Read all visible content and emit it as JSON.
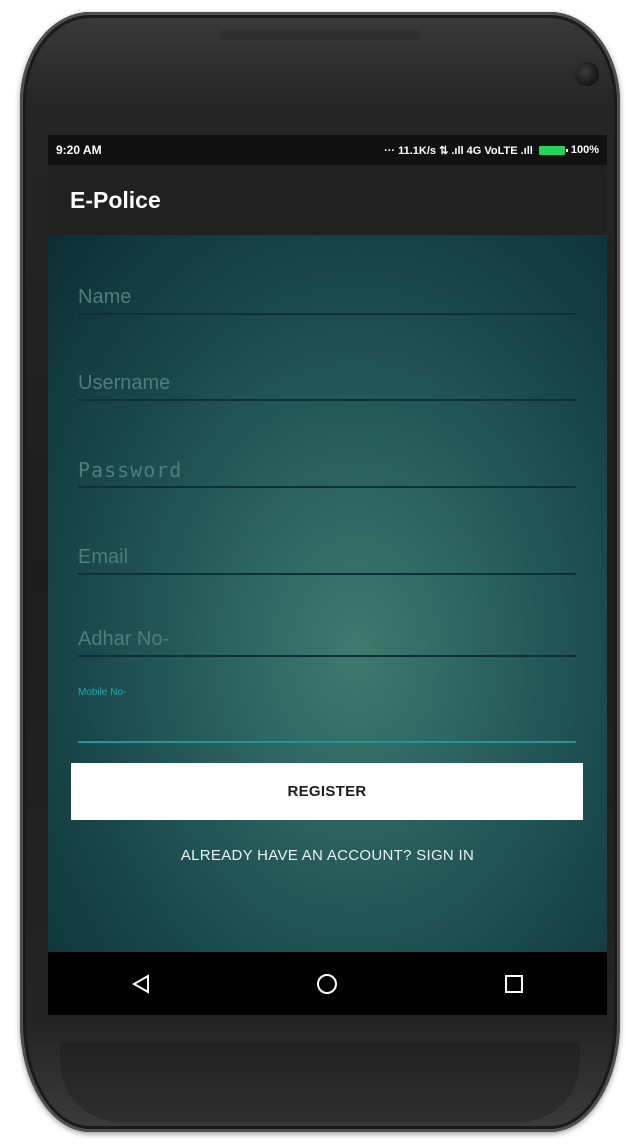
{
  "status_bar": {
    "time": "9:20 AM",
    "network_info": "··· 11.1K/s ⇅ .ıll 4G VoLTE .ıll",
    "battery": "100%",
    "battery_color": "#22d45a"
  },
  "app_bar": {
    "title": "E-Police"
  },
  "form": {
    "name_placeholder": "Name",
    "username_placeholder": "Username",
    "password_placeholder": "Password",
    "email_placeholder": "Email",
    "adhar_placeholder": "Adhar No-",
    "mobile_label": "Mobile No-"
  },
  "actions": {
    "register_label": "REGISTER",
    "signin_label": "ALREADY HAVE AN ACCOUNT? SIGN IN"
  },
  "nav": {
    "back_icon": "back-triangle-icon",
    "home_icon": "home-circle-icon",
    "recents_icon": "recents-square-icon"
  },
  "colors": {
    "app_bar": "#212121",
    "accent": "#139c9f"
  }
}
